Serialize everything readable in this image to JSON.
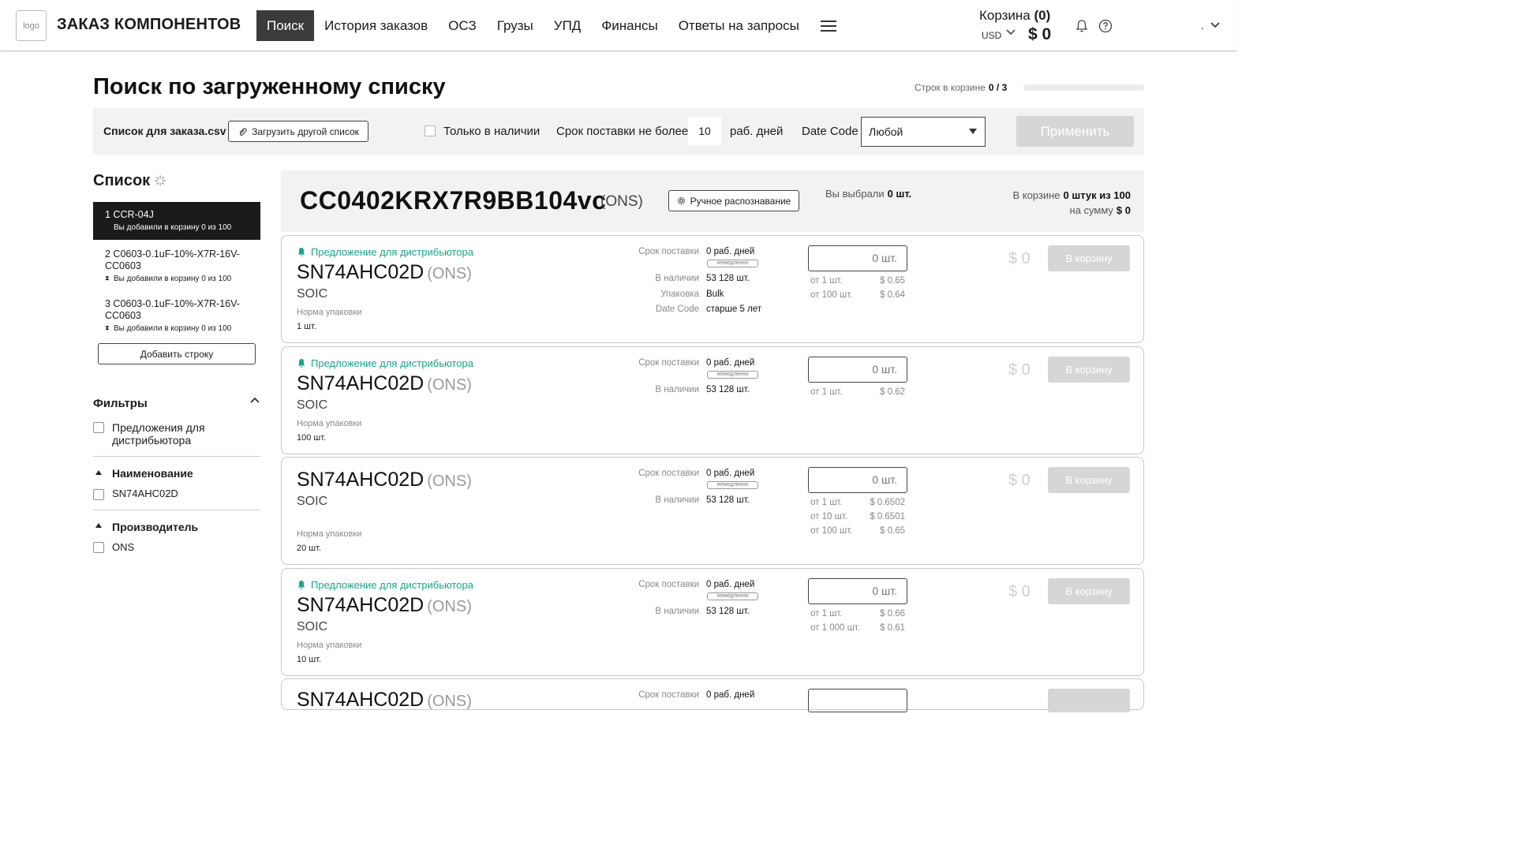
{
  "header": {
    "logo": "logo",
    "brand": "ЗАКАЗ КОМПОНЕНТОВ",
    "nav": [
      "Поиск",
      "История заказов",
      "ОСЗ",
      "Грузы",
      "УПД",
      "Финансы",
      "Ответы на запросы"
    ],
    "cart_title": "Корзина",
    "cart_count": "(0)",
    "currency": "USD",
    "cart_total": "$ 0",
    "user": "."
  },
  "page": {
    "title": "Поиск по загруженному списку",
    "rows_in_cart_label": "Строк в корзине",
    "rows_in_cart_value": "0 / 3",
    "rows_progress": 0
  },
  "filterbar": {
    "file_name": "Список для заказа.csv",
    "upload_label": "Загрузить другой список",
    "in_stock_label": "Только в наличии",
    "in_stock_checked": false,
    "term_label": "Срок поставки не более",
    "term_value": "10",
    "term_unit": "раб. дней",
    "date_code_label": "Date Code",
    "date_code_value": "Любой",
    "apply_label": "Применить"
  },
  "sidebar": {
    "list_title": "Список",
    "items": [
      {
        "name": "1 CCR-04J",
        "sub": "Вы добавили в корзину 0 из 100"
      },
      {
        "name": "2 C0603-0.1uF-10%-X7R-16V-CC0603",
        "sub": "Вы добавили в корзину 0 из 100"
      },
      {
        "name": "3 C0603-0.1uF-10%-X7R-16V-CC0603",
        "sub": "Вы добавили в корзину 0 из 100"
      }
    ],
    "add_row_label": "Добавить строку",
    "filters_title": "Фильтры",
    "filter_distributor": "Предложения для дистрибьютора",
    "section_name_title": "Наименование",
    "section_name_option": "SN74AHC02D",
    "section_mfr_title": "Производитель",
    "section_mfr_option": "ONS"
  },
  "part": {
    "number": "CC0402KRX7R9BB104vc",
    "manufacturer": "(ONS)",
    "manual_label": "Ручное распознавание",
    "chosen_label": "Вы выбрали",
    "chosen_value": "0 шт.",
    "in_cart_label": "В корзине",
    "in_cart_value": "0 штук из 100",
    "sum_label": "на сумму",
    "sum_value": "$ 0"
  },
  "labels": {
    "distributor": "Предложение для дистрибьютора",
    "norm": "Норма упаковки",
    "term": "Срок поставки",
    "stock": "В наличии",
    "packaging": "Упаковка",
    "date_code": "Date Code",
    "immediate": "немедленно",
    "to_cart": "В корзину"
  },
  "offers": [
    {
      "part": "SN74AHC02D",
      "mfr": "(ONS)",
      "package": "SOIC",
      "norm": "1 шт.",
      "term": "0 раб. дней",
      "stock": "53 128 шт.",
      "packaging": "Bulk",
      "date_code": "старше 5 лет",
      "qty": "0 шт.",
      "price": "$ 0",
      "tiers": [
        {
          "q": "от 1 шт.",
          "p": "$ 0.65"
        },
        {
          "q": "от 100 шт.",
          "p": "$ 0.64"
        }
      ]
    },
    {
      "part": "SN74AHC02D",
      "mfr": "(ONS)",
      "package": "SOIC",
      "norm": "100 шт.",
      "term": "0 раб. дней",
      "stock": "53 128 шт.",
      "qty": "0 шт.",
      "price": "$ 0",
      "tiers": [
        {
          "q": "от 1 шт.",
          "p": "$ 0.62"
        }
      ]
    },
    {
      "part": "SN74AHC02D",
      "mfr": "(ONS)",
      "package": "SOIC",
      "norm": "20 шт.",
      "term": "0 раб. дней",
      "stock": "53 128 шт.",
      "qty": "0 шт.",
      "price": "$ 0",
      "tiers": [
        {
          "q": "от 1 шт.",
          "p": "$ 0.6502"
        },
        {
          "q": "от 10 шт.",
          "p": "$ 0.6501"
        },
        {
          "q": "от 100 шт.",
          "p": "$ 0.65"
        }
      ]
    },
    {
      "part": "SN74AHC02D",
      "mfr": "(ONS)",
      "package": "SOIC",
      "norm": "10 шт.",
      "term": "0 раб. дней",
      "stock": "53 128 шт.",
      "qty": "0 шт.",
      "price": "$ 0",
      "tiers": [
        {
          "q": "от 1 шт.",
          "p": "$ 0.66"
        },
        {
          "q": "от 1 000 шт.",
          "p": "$ 0.61"
        }
      ]
    },
    {
      "part": "SN74AHC02D",
      "mfr": "(ONS)",
      "term": "0 раб. дней"
    }
  ],
  "colors": {
    "accent_green": "#19a38a",
    "active_nav": "#3b3b3b",
    "panel_bg": "#f2f2f2",
    "disabled_button": "#d6d6d6"
  }
}
